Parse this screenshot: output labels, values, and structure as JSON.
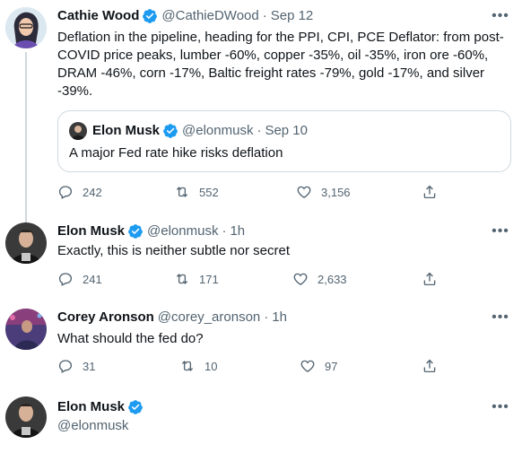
{
  "colors": {
    "verified": "#1d9bf0",
    "secondary": "#536471",
    "line": "#cfd9de"
  },
  "tweets": [
    {
      "name": "Cathie Wood",
      "handle": "@CathieDWood",
      "time": "Sep 12",
      "text": "Deflation in the pipeline, heading for the PPI, CPI, PCE Deflator: from post-COVID price peaks, lumber -60%, copper -35%, oil -35%, iron ore -60%, DRAM -46%, corn -17%, Baltic freight rates -79%, gold -17%, and silver -39%.",
      "quote": {
        "name": "Elon Musk",
        "handle": "@elonmusk",
        "time": "Sep 10",
        "text": "A major Fed rate hike risks deflation"
      },
      "replies": "242",
      "retweets": "552",
      "likes": "3,156"
    },
    {
      "name": "Elon Musk",
      "handle": "@elonmusk",
      "time": "1h",
      "text": "Exactly, this is neither subtle nor secret",
      "replies": "241",
      "retweets": "171",
      "likes": "2,633"
    },
    {
      "name": "Corey Aronson",
      "handle": "@corey_aronson",
      "time": "1h",
      "text": "What should the fed do?",
      "replies": "31",
      "retweets": "10",
      "likes": "97"
    },
    {
      "name": "Elon Musk",
      "handle": "@elonmusk"
    }
  ],
  "separator": "·"
}
